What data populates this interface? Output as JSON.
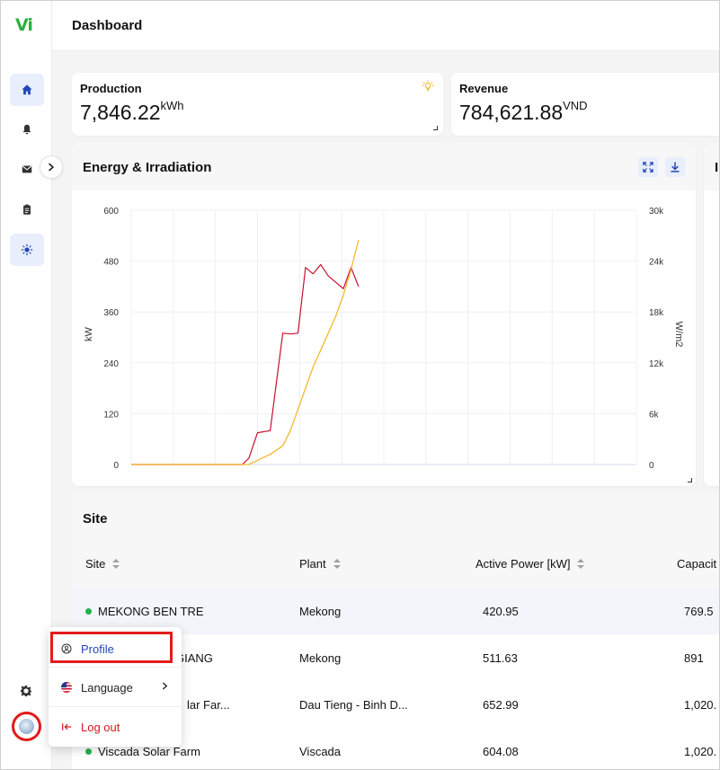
{
  "app": {
    "logo": "Vi",
    "header_title": "Dashboard"
  },
  "kpis": [
    {
      "label": "Production",
      "value": "7,846.22",
      "unit": "kWh",
      "icon": "lightbulb-icon"
    },
    {
      "label": "Revenue",
      "value": "784,621.88",
      "unit": "VND"
    }
  ],
  "energy_chart": {
    "title": "Energy & Irradiation",
    "partial_next_title": "Ir",
    "y_left_label": "kW",
    "y_right_label": "W/m2",
    "y_left_ticks": [
      "600",
      "480",
      "360",
      "240",
      "120",
      "0"
    ],
    "y_right_ticks": [
      "30k",
      "24k",
      "18k",
      "12k",
      "6k",
      "0"
    ]
  },
  "chart_data": {
    "type": "line",
    "ylabel": "kW",
    "y2label": "W/m2",
    "ylim": [
      0,
      600
    ],
    "y2lim": [
      0,
      30000
    ],
    "grid": true,
    "x": [
      0,
      0.22,
      0.233,
      0.25,
      0.275,
      0.3,
      0.315,
      0.33,
      0.345,
      0.36,
      0.375,
      0.39,
      0.405,
      0.42,
      0.435,
      0.45
    ],
    "series": [
      {
        "color": "#c8102e",
        "axis": "left",
        "values": [
          0,
          0,
          15,
          75,
          80,
          310,
          308,
          310,
          465,
          450,
          472,
          445,
          430,
          415,
          465,
          420
        ]
      },
      {
        "color": "#f5b82e",
        "axis": "right",
        "values": [
          0,
          0,
          0,
          500,
          1200,
          2200,
          4000,
          6500,
          9000,
          11500,
          13500,
          15500,
          17500,
          20000,
          23000,
          26500
        ]
      }
    ]
  },
  "site_table": {
    "title": "Site",
    "columns": [
      "Site",
      "Plant",
      "Active Power [kW]",
      "Capacit"
    ],
    "rows": [
      {
        "site": "MEKONG BEN TRE",
        "plant": "Mekong",
        "active_power": "420.95",
        "capacity": "769.5"
      },
      {
        "site": "GIANG",
        "plant": "Mekong",
        "active_power": "511.63",
        "capacity": "891"
      },
      {
        "site": "lar Far...",
        "plant": "Dau Tieng - Binh D...",
        "active_power": "652.99",
        "capacity": "1,020."
      },
      {
        "site": "Viscada Solar Farm",
        "plant": "Viscada",
        "active_power": "604.08",
        "capacity": "1,020."
      }
    ]
  },
  "user_menu": {
    "items": [
      {
        "label": "Profile",
        "icon": "user-circle-icon"
      },
      {
        "label": "Language",
        "icon": "flag-icon"
      },
      {
        "label": "Log out",
        "icon": "logout-icon"
      }
    ]
  },
  "colors": {
    "accent": "#2447b8",
    "brand": "#2fae3f",
    "highlight": "#e31b1b",
    "power": "#c8102e",
    "irradiation": "#f5b82e"
  }
}
